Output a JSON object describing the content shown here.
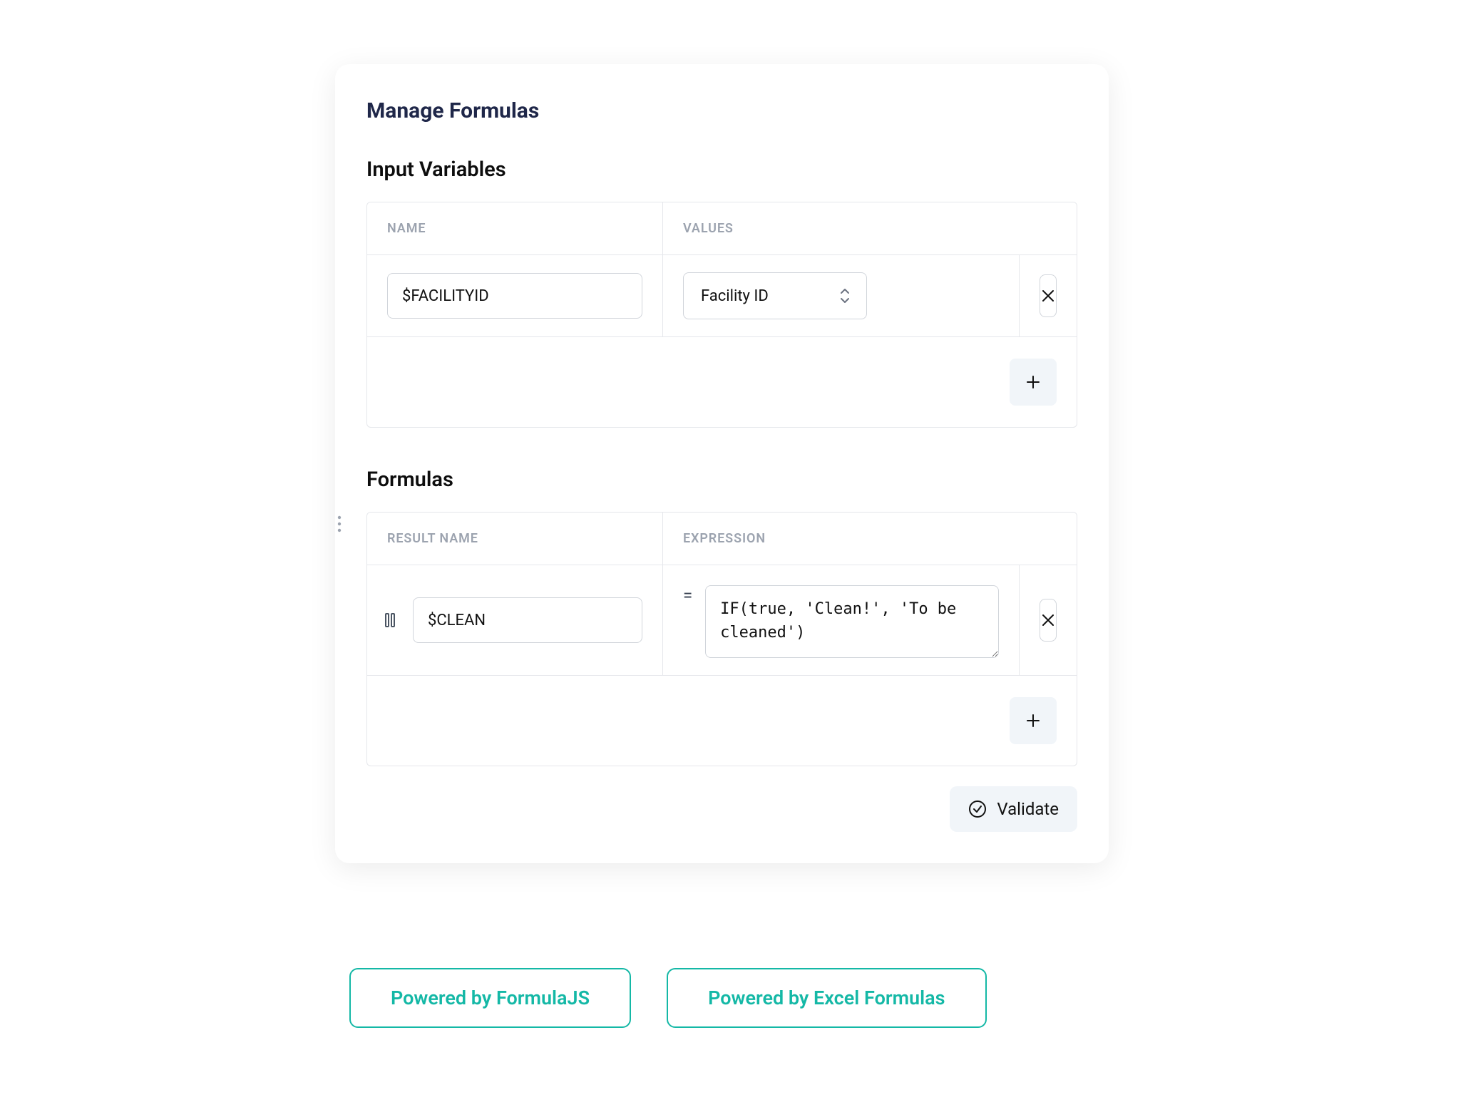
{
  "card": {
    "title": "Manage Formulas",
    "input_vars": {
      "heading": "Input Variables",
      "columns": {
        "name": "NAME",
        "values": "VALUES"
      },
      "rows": [
        {
          "name": "$FACILITYID",
          "value_selected": "Facility ID"
        }
      ]
    },
    "formulas": {
      "heading": "Formulas",
      "columns": {
        "result": "RESULT NAME",
        "expression": "EXPRESSION"
      },
      "rows": [
        {
          "result": "$CLEAN",
          "equals": "=",
          "expression": "IF(true, 'Clean!', 'To be cleaned')"
        }
      ]
    },
    "validate_label": "Validate"
  },
  "footer": {
    "link1": "Powered by FormulaJS",
    "link2": "Powered by Excel Formulas"
  }
}
